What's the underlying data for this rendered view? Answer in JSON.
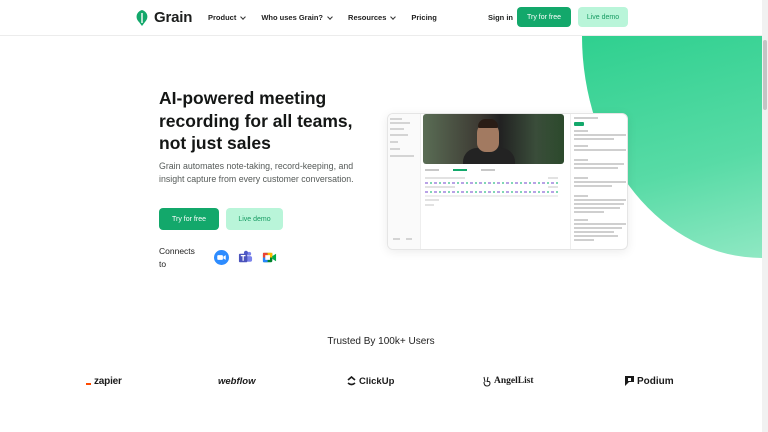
{
  "nav": {
    "brand": "Grain",
    "links": [
      {
        "label": "Product",
        "dropdown": true
      },
      {
        "label": "Who uses Grain?",
        "dropdown": true
      },
      {
        "label": "Resources",
        "dropdown": true
      },
      {
        "label": "Pricing",
        "dropdown": false
      }
    ],
    "sign_in": "Sign in",
    "try_free": "Try for free",
    "live_demo": "Live demo"
  },
  "hero": {
    "title": "AI-powered meeting recording for all teams, not just sales",
    "subtitle": "Grain automates note-taking, record-keeping, and insight capture from every customer conversation.",
    "try_free": "Try for free",
    "live_demo": "Live demo",
    "connects_label": "Connects to",
    "integrations": [
      "zoom-icon",
      "microsoft-teams-icon",
      "google-meet-icon"
    ]
  },
  "trusted": {
    "heading": "Trusted By 100k+ Users",
    "brands": [
      "zapier",
      "webflow",
      "ClickUp",
      "AngelList",
      "Podium"
    ]
  },
  "colors": {
    "accent": "#13a86b",
    "accent_light": "#b9f5d9",
    "blob": "#3dd497"
  }
}
